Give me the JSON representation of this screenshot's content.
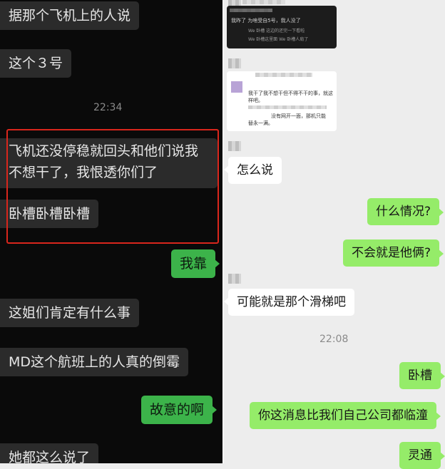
{
  "left": {
    "messages": [
      {
        "text": "据那个飞机上的人说"
      },
      {
        "text": "这个３号"
      },
      {
        "text": "飞机还没停稳就回头和他们说我"
      },
      {
        "text": "不想干了，我恨透你们了"
      },
      {
        "text": "卧槽卧槽卧槽"
      },
      {
        "text": "我靠"
      },
      {
        "text": "这姐们肯定有什么事"
      },
      {
        "text": "MD这个航班上的人真的倒霉"
      },
      {
        "text": "故意的啊"
      },
      {
        "text": "她都这么说了"
      }
    ],
    "time": "22:34"
  },
  "right": {
    "card1": {
      "line1": "我昨了 为啥受自5号，我人没了",
      "line2": "We 卧槽 这边的还完一下看啦",
      "line3": "We 卧槽这里面 We 卧槽人肩了"
    },
    "card2": {
      "line1": "我干了我不想干但不得不干的事，就这",
      "line2": "样吧。",
      "line3": "没有网开一面，那机只能",
      "line4": "替永一满。"
    },
    "messages": [
      {
        "text": "怎么说"
      },
      {
        "text": "什么情况?"
      },
      {
        "text": "不会就是他俩?"
      },
      {
        "text": "可能就是那个滑梯吧"
      },
      {
        "text": "卧槽"
      },
      {
        "text": "你这消息比我们自己公司都临潼"
      },
      {
        "text": "灵通"
      }
    ],
    "time": "22:08"
  }
}
